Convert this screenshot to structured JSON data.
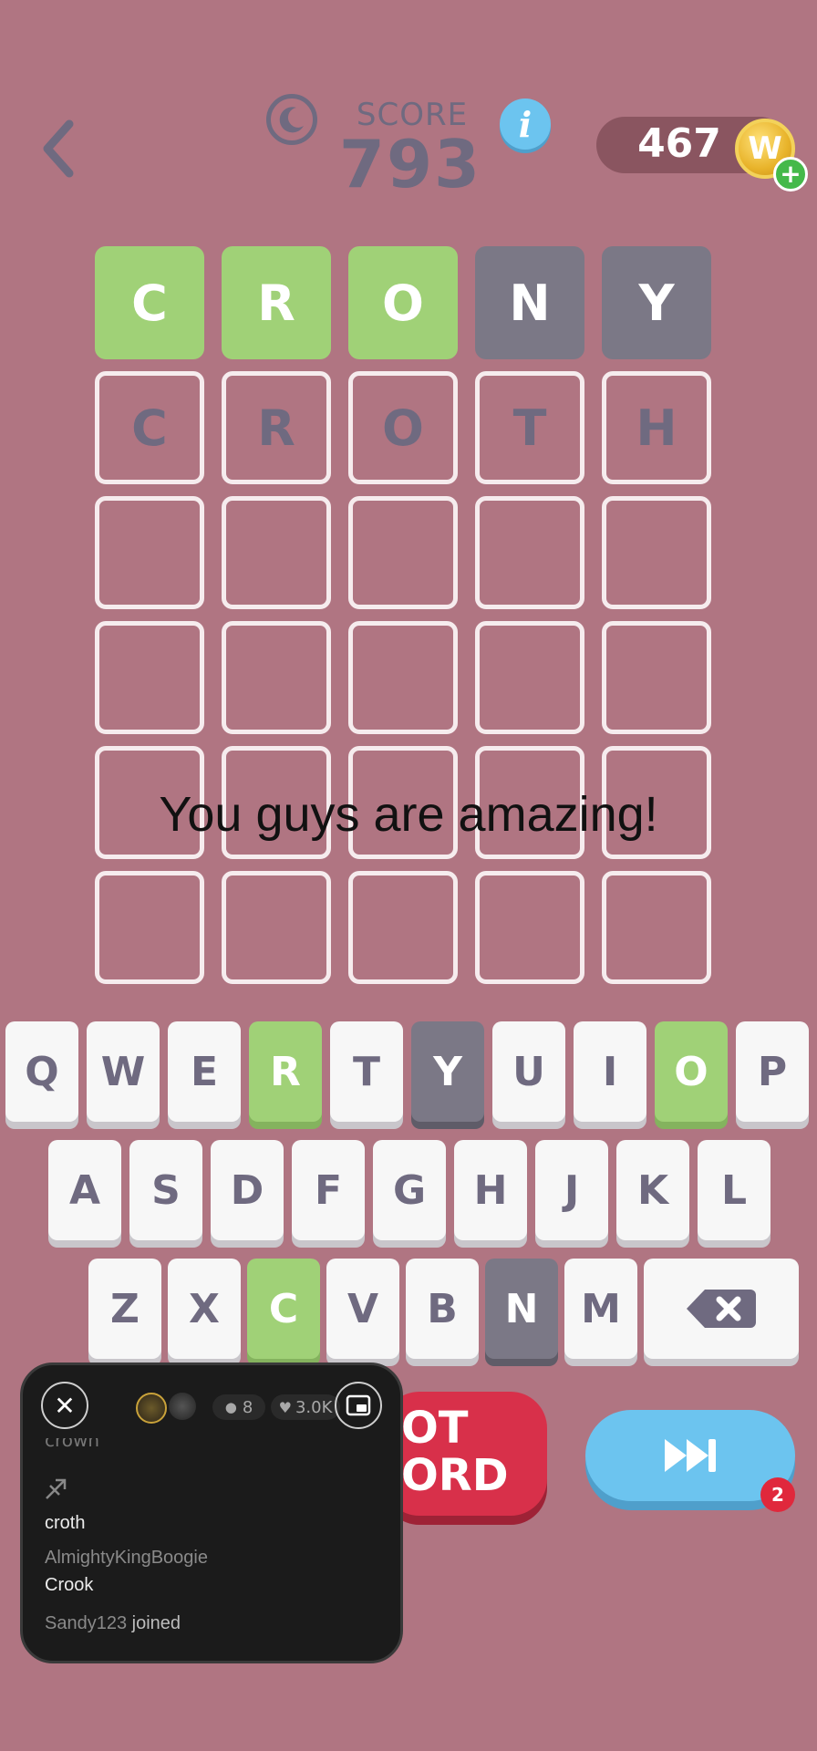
{
  "header": {
    "score_label": "SCORE",
    "score_value": "793",
    "info_label": "i",
    "coins": "467",
    "coin_symbol": "W",
    "plus_label": "+"
  },
  "grid": {
    "rows": [
      [
        {
          "letter": "C",
          "state": "green"
        },
        {
          "letter": "R",
          "state": "green"
        },
        {
          "letter": "O",
          "state": "green"
        },
        {
          "letter": "N",
          "state": "gray"
        },
        {
          "letter": "Y",
          "state": "gray"
        }
      ],
      [
        {
          "letter": "C",
          "state": "typed"
        },
        {
          "letter": "R",
          "state": "typed"
        },
        {
          "letter": "O",
          "state": "typed"
        },
        {
          "letter": "T",
          "state": "typed"
        },
        {
          "letter": "H",
          "state": "typed"
        }
      ],
      [
        {
          "letter": "",
          "state": "empty"
        },
        {
          "letter": "",
          "state": "empty"
        },
        {
          "letter": "",
          "state": "empty"
        },
        {
          "letter": "",
          "state": "empty"
        },
        {
          "letter": "",
          "state": "empty"
        }
      ],
      [
        {
          "letter": "",
          "state": "empty"
        },
        {
          "letter": "",
          "state": "empty"
        },
        {
          "letter": "",
          "state": "empty"
        },
        {
          "letter": "",
          "state": "empty"
        },
        {
          "letter": "",
          "state": "empty"
        }
      ],
      [
        {
          "letter": "",
          "state": "empty"
        },
        {
          "letter": "",
          "state": "empty"
        },
        {
          "letter": "",
          "state": "empty"
        },
        {
          "letter": "",
          "state": "empty"
        },
        {
          "letter": "",
          "state": "empty"
        }
      ],
      [
        {
          "letter": "",
          "state": "empty"
        },
        {
          "letter": "",
          "state": "empty"
        },
        {
          "letter": "",
          "state": "empty"
        },
        {
          "letter": "",
          "state": "empty"
        },
        {
          "letter": "",
          "state": "empty"
        }
      ]
    ]
  },
  "overlay_text": "You guys are amazing!",
  "keyboard": {
    "row1": [
      {
        "k": "Q",
        "s": ""
      },
      {
        "k": "W",
        "s": ""
      },
      {
        "k": "E",
        "s": ""
      },
      {
        "k": "R",
        "s": "green"
      },
      {
        "k": "T",
        "s": ""
      },
      {
        "k": "Y",
        "s": "gray"
      },
      {
        "k": "U",
        "s": ""
      },
      {
        "k": "I",
        "s": ""
      },
      {
        "k": "O",
        "s": "green"
      },
      {
        "k": "P",
        "s": ""
      }
    ],
    "row2": [
      {
        "k": "A",
        "s": ""
      },
      {
        "k": "S",
        "s": ""
      },
      {
        "k": "D",
        "s": ""
      },
      {
        "k": "F",
        "s": ""
      },
      {
        "k": "G",
        "s": ""
      },
      {
        "k": "H",
        "s": ""
      },
      {
        "k": "J",
        "s": ""
      },
      {
        "k": "K",
        "s": ""
      },
      {
        "k": "L",
        "s": ""
      }
    ],
    "row3": [
      {
        "k": "Z",
        "s": ""
      },
      {
        "k": "X",
        "s": ""
      },
      {
        "k": "C",
        "s": "green"
      },
      {
        "k": "V",
        "s": ""
      },
      {
        "k": "B",
        "s": ""
      },
      {
        "k": "N",
        "s": "gray"
      },
      {
        "k": "M",
        "s": ""
      }
    ]
  },
  "buttons": {
    "not_word_line1": "OT",
    "not_word_line2": "ORD",
    "skip_badge": "2"
  },
  "live_panel": {
    "viewers": "8",
    "likes": "3.0K",
    "faded_top": "crown",
    "messages": [
      {
        "name": "",
        "text": "croth"
      },
      {
        "name": "AlmightyKingBoogie",
        "text": "Crook"
      }
    ],
    "join_user": "Sandy123",
    "join_text": "joined"
  },
  "colors": {
    "background": "#b07582",
    "green": "#a0d177",
    "gray": "#7b7886",
    "red": "#d8304a",
    "blue": "#6cc4ef"
  }
}
